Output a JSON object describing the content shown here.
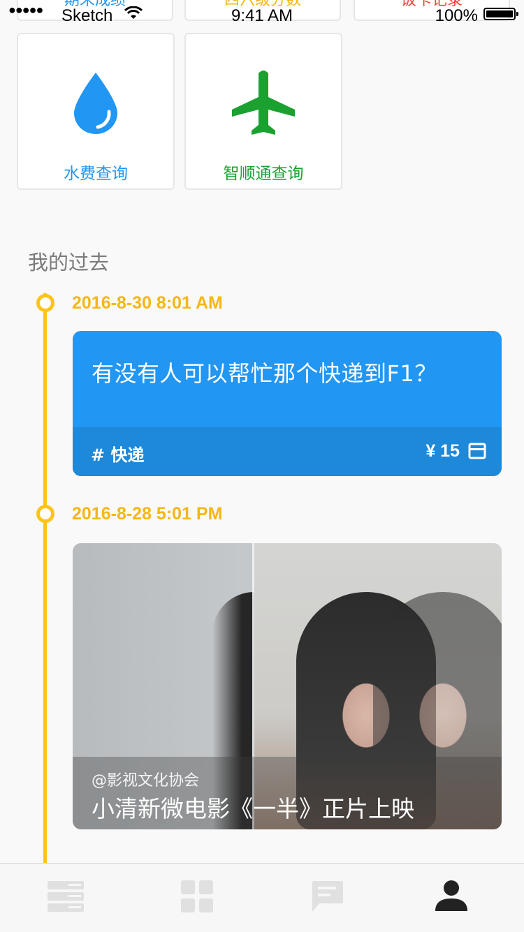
{
  "status_bar": {
    "signal": "●●●●●",
    "carrier": "Sketch",
    "time": "9:41 AM",
    "battery": "100%"
  },
  "top_tiles": [
    {
      "label": "期末成绩",
      "color": "#2196f3"
    },
    {
      "label": "四六级分数",
      "color": "#f5b716"
    },
    {
      "label": "饭卡记录",
      "color": "#f44336"
    }
  ],
  "quick_tiles": [
    {
      "label": "水费查询",
      "icon": "water-drop-icon",
      "color": "#2196f3"
    },
    {
      "label": "智顺通查询",
      "icon": "airplane-icon",
      "color": "#1aa130"
    }
  ],
  "section": {
    "title": "我的过去"
  },
  "timeline": [
    {
      "date": "2016-8-30 8:01 AM",
      "type": "request",
      "question": "有没有人可以帮忙那个快递到F1？",
      "tag": "# 快递",
      "price": "¥ 15",
      "icon": "card-icon"
    },
    {
      "date": "2016-8-28 5:01 PM",
      "type": "media",
      "author": "@影视文化协会",
      "title": "小清新微电影《一半》正片上映"
    }
  ],
  "tabbar": {
    "tabs": [
      {
        "icon": "list-icon",
        "color": "#e0e0e0"
      },
      {
        "icon": "grid-icon",
        "color": "#e0e0e0"
      },
      {
        "icon": "chat-icon",
        "color": "#e0e0e0"
      },
      {
        "icon": "person-icon",
        "color": "#222222",
        "active": true
      }
    ]
  }
}
